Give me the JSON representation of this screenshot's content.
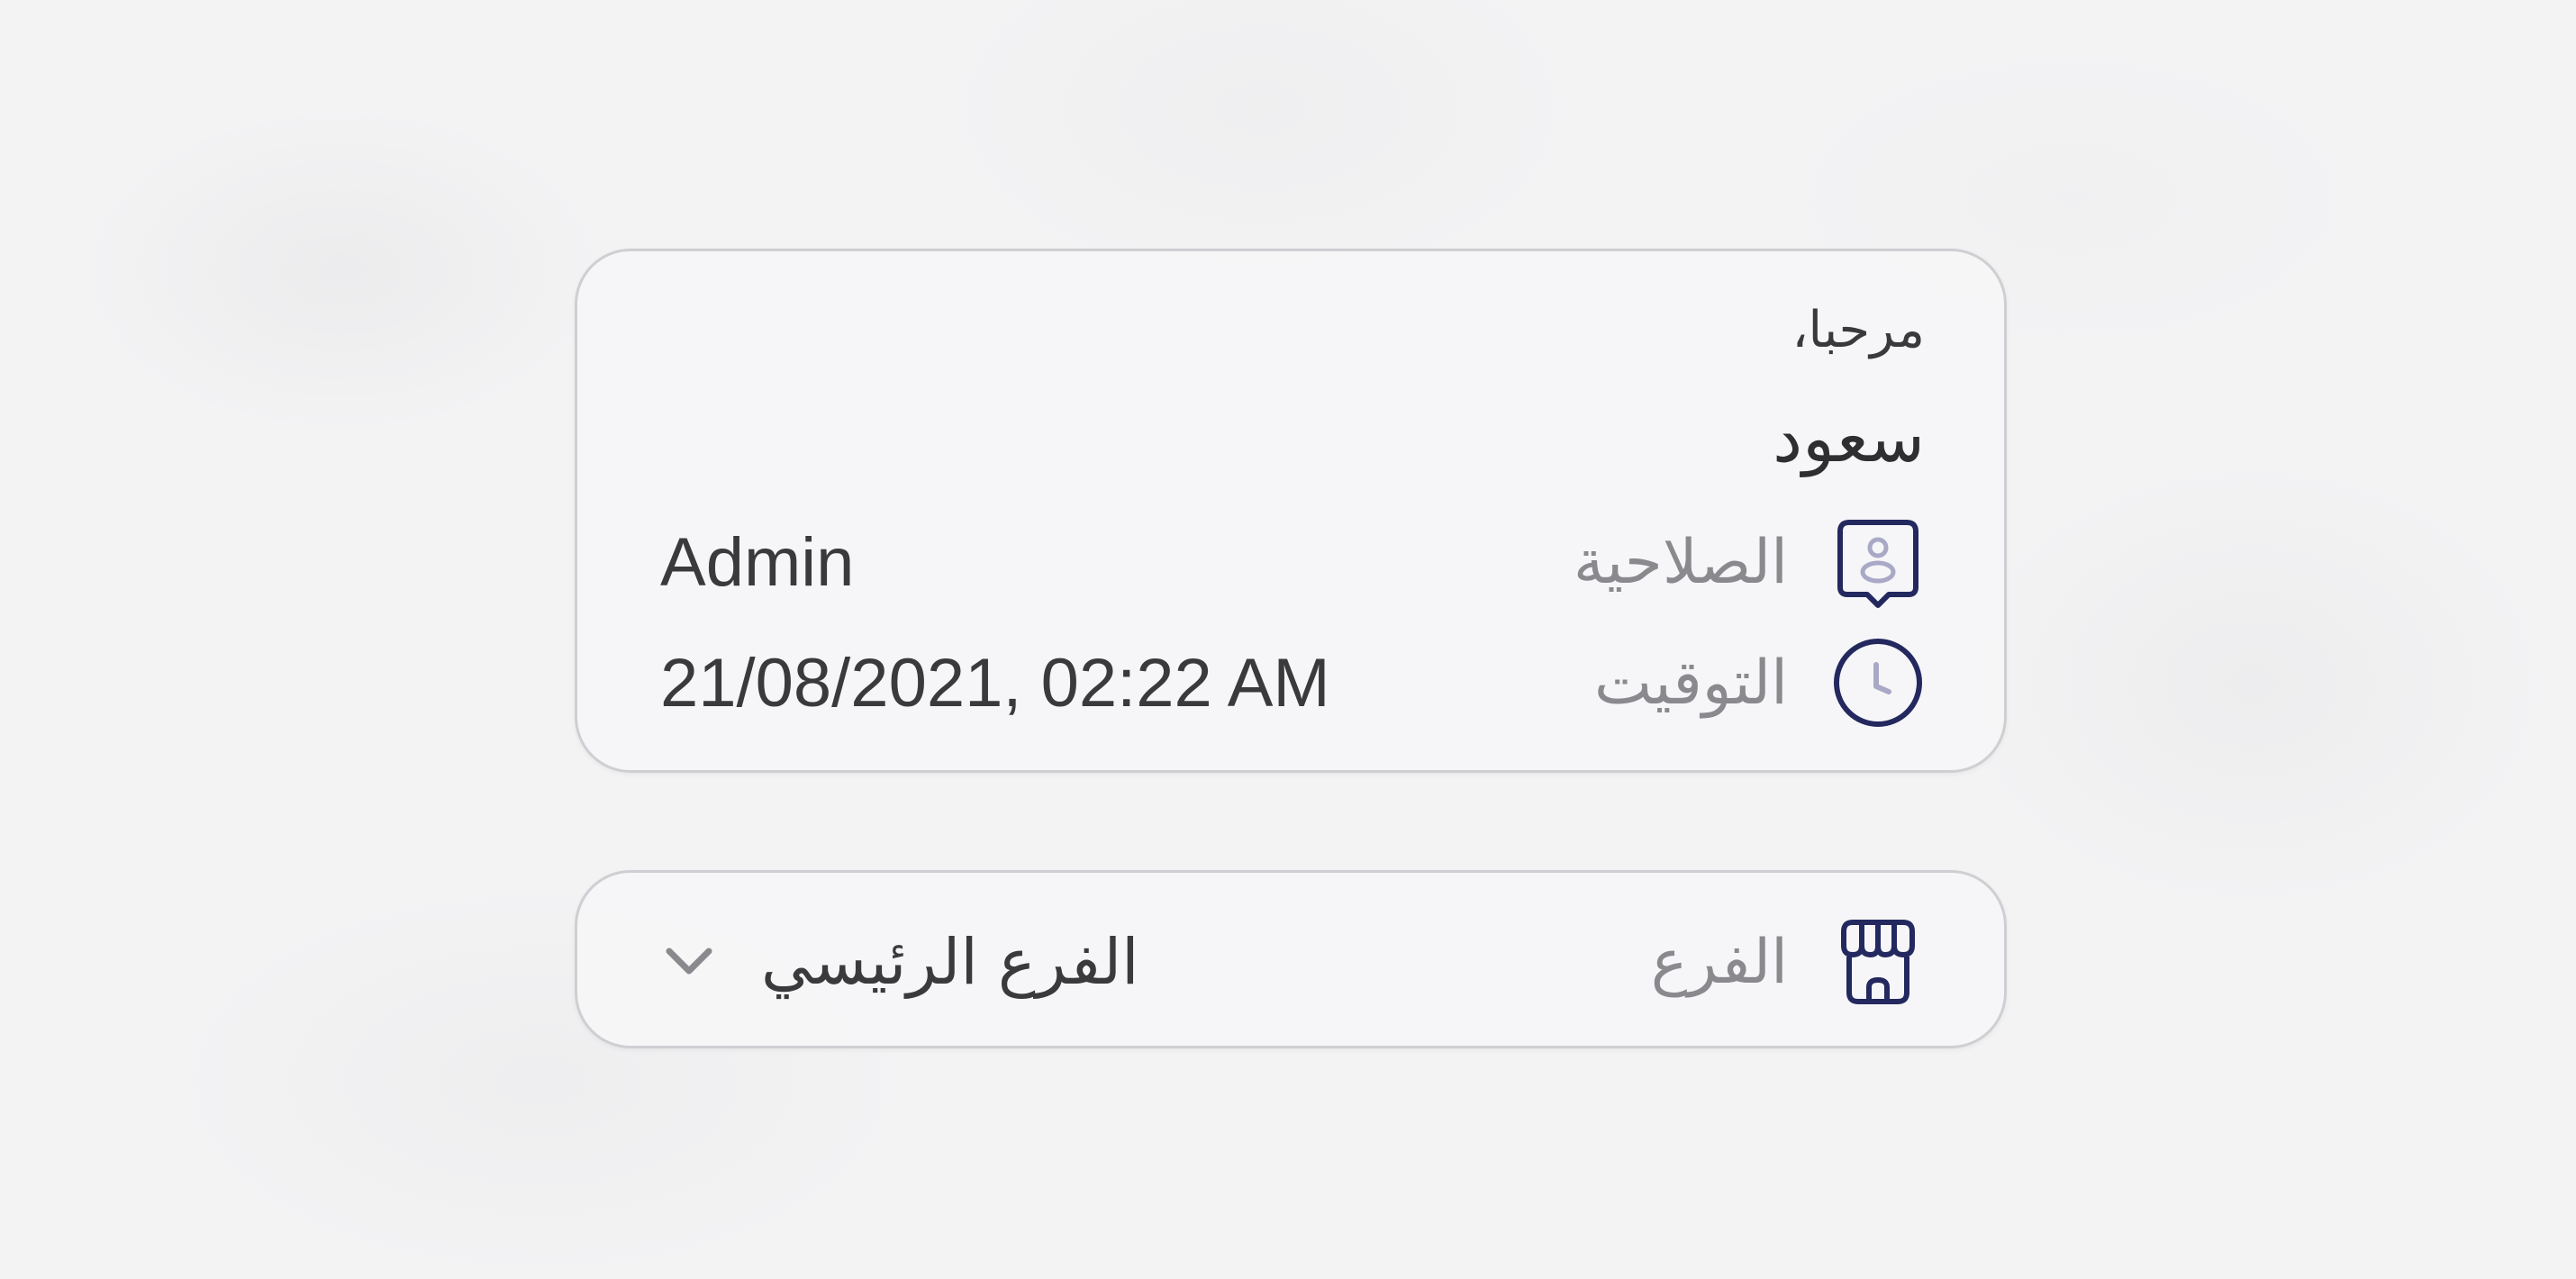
{
  "user_card": {
    "greeting": "مرحبا،",
    "user_name": "سعود",
    "role": {
      "icon": "user-badge-icon",
      "label": "الصلاحية",
      "value": "Admin"
    },
    "time": {
      "icon": "clock-icon",
      "label": "التوقيت",
      "value": "21/08/2021, 02:22 AM"
    }
  },
  "branch_card": {
    "icon": "store-icon",
    "label": "الفرع",
    "selected_branch": "الفرع الرئيسي",
    "dropdown_icon": "chevron-down-icon"
  },
  "colors": {
    "icon_primary": "#23285f",
    "icon_secondary": "#a9a9c7",
    "label_text": "#8a8a8e",
    "value_text": "#3a3a3c",
    "card_border": "#cfcfd3"
  }
}
